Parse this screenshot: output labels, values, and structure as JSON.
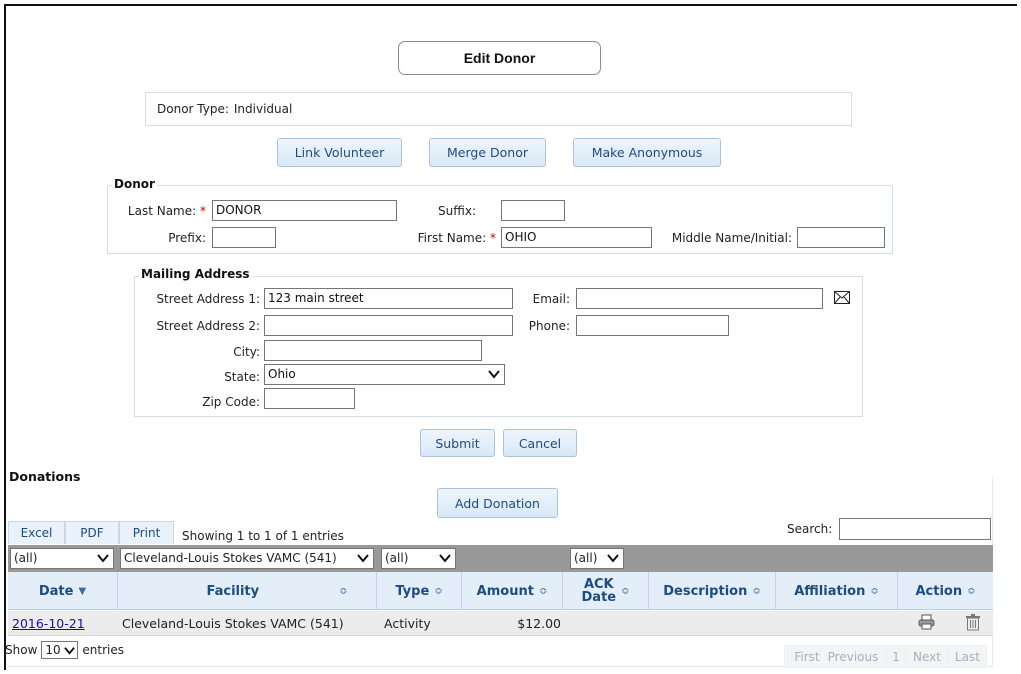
{
  "title_button": "Edit Donor",
  "donor_type": {
    "label": "Donor Type:",
    "value": "Individual"
  },
  "action_buttons": {
    "link_volunteer": "Link Volunteer",
    "merge_donor": "Merge Donor",
    "make_anonymous": "Make Anonymous"
  },
  "donor": {
    "legend": "Donor",
    "last_name_label": "Last Name:",
    "last_name": "DONOR",
    "suffix_label": "Suffix:",
    "suffix": "",
    "prefix_label": "Prefix:",
    "prefix": "",
    "first_name_label": "First Name:",
    "first_name": "OHIO",
    "middle_label": "Middle Name/Initial:",
    "middle": "",
    "required_mark": "*"
  },
  "mailing": {
    "legend": "Mailing Address",
    "street1_label": "Street Address 1:",
    "street1": "123 main street",
    "street2_label": "Street Address 2:",
    "street2": "",
    "city_label": "City:",
    "city": "",
    "state_label": "State:",
    "state": "Ohio",
    "zip_label": "Zip Code:",
    "zip": "",
    "email_label": "Email:",
    "email": "",
    "phone_label": "Phone:",
    "phone": ""
  },
  "form_buttons": {
    "submit": "Submit",
    "cancel": "Cancel"
  },
  "donations": {
    "heading": "Donations",
    "add_button": "Add Donation",
    "export_tabs": [
      "Excel",
      "PDF",
      "Print"
    ],
    "info": "Showing 1 to 1 of 1 entries",
    "search_label": "Search:",
    "filters": {
      "date": "(all)",
      "facility": "Cleveland-Louis Stokes VAMC (541)",
      "type": "(all)",
      "ack_date": "(all)"
    },
    "columns": {
      "date": "Date",
      "facility": "Facility",
      "type": "Type",
      "amount": "Amount",
      "ack_date_1": "ACK",
      "ack_date_2": "Date",
      "description": "Description",
      "affiliation": "Affiliation",
      "action": "Action"
    },
    "rows": [
      {
        "date": "2016-10-21",
        "facility": "Cleveland-Louis Stokes VAMC (541)",
        "type": "Activity",
        "amount": "$12.00",
        "ack_date": "",
        "description": "",
        "affiliation": ""
      }
    ],
    "length": {
      "show": "Show",
      "value": "10",
      "entries": "entries"
    },
    "pager": {
      "first": "First",
      "previous": "Previous",
      "page": "1",
      "next": "Next",
      "last": "Last"
    }
  },
  "colors": {
    "link": "#1a0dab",
    "button_text": "#1c4c82",
    "required": "#cc0000",
    "header_bg": "#e3eef9",
    "filter_bar": "#999999"
  }
}
